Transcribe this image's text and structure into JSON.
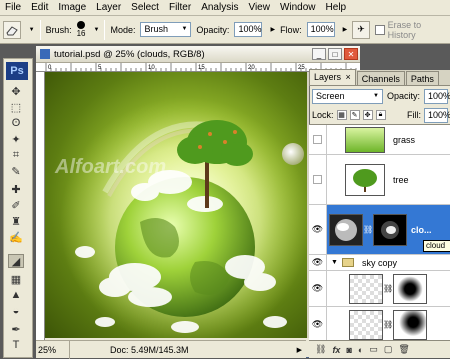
{
  "menu": [
    "File",
    "Edit",
    "Image",
    "Layer",
    "Select",
    "Filter",
    "Analysis",
    "View",
    "Window",
    "Help"
  ],
  "options": {
    "brush_label": "Brush:",
    "brush_size": "16",
    "mode_label": "Mode:",
    "mode_value": "Brush",
    "opacity_label": "Opacity:",
    "opacity_value": "100%",
    "flow_label": "Flow:",
    "flow_value": "100%",
    "erase_history": "Erase to History"
  },
  "toolbox": {
    "logo": "Ps"
  },
  "document": {
    "title": "tutorial.psd @ 25% (clouds, RGB/8)",
    "ruler_marks": [
      "0",
      "5",
      "10",
      "15",
      "20",
      "25"
    ],
    "watermark": "Alfoart.com",
    "zoom": "25%",
    "doc_info": "Doc: 5.49M/145.3M"
  },
  "layers_panel": {
    "tabs": [
      "Layers",
      "Channels",
      "Paths"
    ],
    "tab_close": "×",
    "blend_mode": "Screen",
    "opacity_label": "Opacity:",
    "opacity_value": "100%",
    "lock_label": "Lock:",
    "fill_label": "Fill:",
    "fill_value": "100%",
    "layers": [
      {
        "name": "grass"
      },
      {
        "name": "tree"
      },
      {
        "name": "clo..."
      },
      {
        "name": "sky copy"
      }
    ],
    "tooltip": "cloud"
  },
  "colors": {
    "selection": "#3478d4",
    "app_bg": "#ece9d8"
  }
}
